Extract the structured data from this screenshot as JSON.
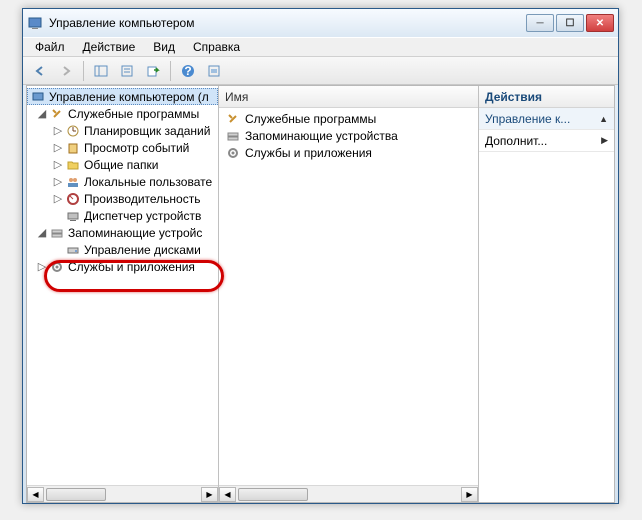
{
  "window": {
    "title": "Управление компьютером"
  },
  "menu": {
    "file": "Файл",
    "action": "Действие",
    "view": "Вид",
    "help": "Справка"
  },
  "tree": {
    "root": "Управление компьютером (л",
    "group1": "Служебные программы",
    "i1": "Планировщик заданий",
    "i2": "Просмотр событий",
    "i3": "Общие папки",
    "i4": "Локальные пользовате",
    "i5": "Производительность",
    "i6": "Диспетчер устройств",
    "group2": "Запоминающие устройс",
    "disk": "Управление дисками",
    "group3": "Службы и приложения"
  },
  "list": {
    "header": "Имя",
    "r1": "Служебные программы",
    "r2": "Запоминающие устройства",
    "r3": "Службы и приложения"
  },
  "actions": {
    "header": "Действия",
    "item1": "Управление к...",
    "item2": "Дополнит..."
  }
}
